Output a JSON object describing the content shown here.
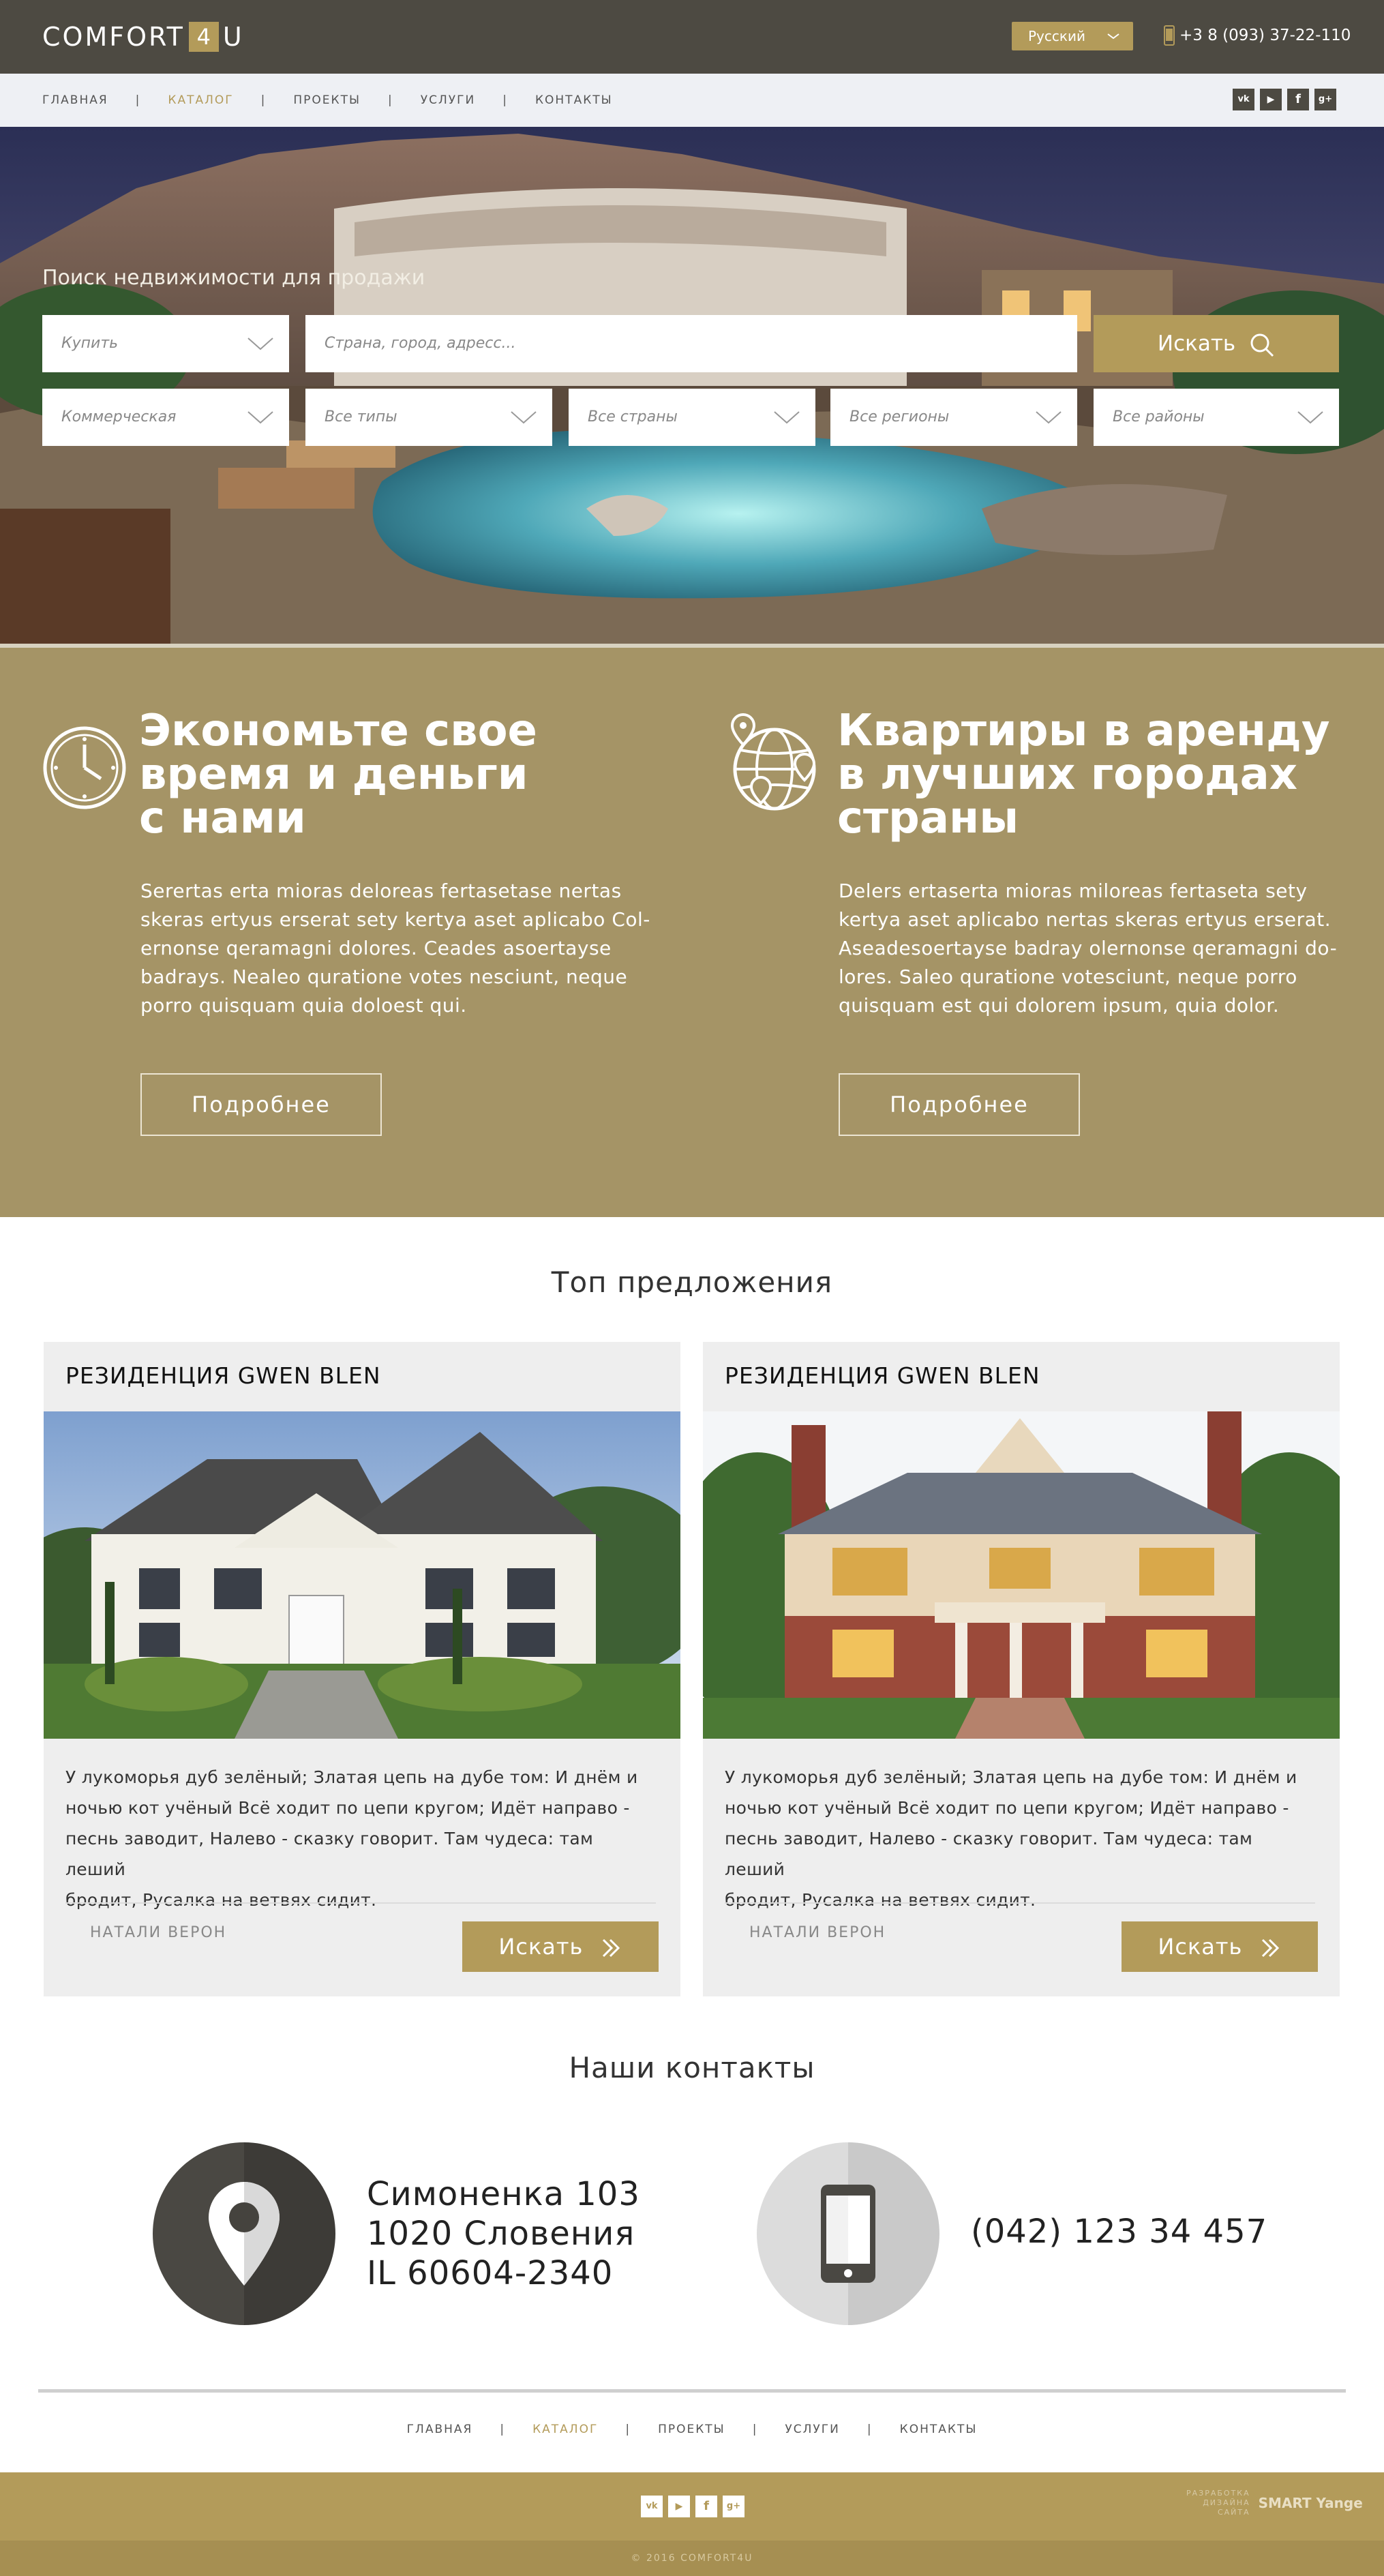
{
  "header": {
    "logo_left": "COMFORT",
    "logo_box": "4",
    "logo_right": "U",
    "language": "Русский",
    "phone": "+3 8 (093) 37-22-110"
  },
  "nav": {
    "items": [
      "ГЛАВНАЯ",
      "КАТАЛОГ",
      "ПРОЕКТЫ",
      "УСЛУГИ",
      "КОНТАКТЫ"
    ],
    "active_index": 1,
    "separator": "|"
  },
  "social": {
    "icons": [
      "vk-icon",
      "youtube-icon",
      "facebook-icon",
      "google-plus-icon"
    ],
    "glyphs": [
      "vk",
      "▶",
      "f",
      "g+"
    ]
  },
  "search": {
    "title": "Поиск недвижимости для продажи",
    "deal_type": "Купить",
    "location_placeholder": "Страна, город, адресс...",
    "button": "Искать",
    "filters": [
      "Коммерческая",
      "Все типы",
      "Все страны",
      "Все регионы",
      "Все районы"
    ]
  },
  "features": [
    {
      "icon": "clock-icon",
      "title_lines": [
        "Экономьте свое",
        "время и деньги",
        "с нами"
      ],
      "text_lines": [
        "Serertas erta mioras deloreas fertasetase nertas",
        "skeras ertyus erserat sety kertya aset aplicabo Col-",
        "ernonse qeramagni dolores. Ceades asoertayse",
        "badrays. Nealeo quratione votes nesciunt, neque",
        "porro quisquam quia doloest qui."
      ],
      "button": "Подробнее"
    },
    {
      "icon": "globe-pins-icon",
      "title_lines": [
        "Квартиры в аренду",
        "в лучших городах",
        "страны"
      ],
      "text_lines": [
        "Delers ertaserta mioras miloreas fertaseta sety",
        "kertya aset aplicabo nertas skeras ertyus erserat.",
        "Aseadesoertayse badray olernonse qeramagni do-",
        "lores. Saleo quratione votesciunt, neque porro",
        "quisquam est qui dolorem ipsum, quia dolor."
      ],
      "button": "Подробнее"
    }
  ],
  "offers": {
    "title": "Топ предложения",
    "cards": [
      {
        "title": "РЕЗИДЕНЦИЯ GWEN BLEN",
        "text_lines": [
          "У лукоморья дуб зелёный; Златая цепь на дубе том: И днём и",
          "ночью кот учёный Всё ходит по цепи кругом; Идёт направо -",
          "песнь заводит, Налево - сказку говорит. Там чудеса: там леший",
          "бродит, Русалка на ветвях сидит."
        ],
        "author": "НАТАЛИ ВЕРОН",
        "button": "Искать"
      },
      {
        "title": "РЕЗИДЕНЦИЯ GWEN BLEN",
        "text_lines": [
          "У лукоморья дуб зелёный; Златая цепь на дубе том: И днём и",
          "ночью кот учёный Всё ходит по цепи кругом; Идёт направо -",
          "песнь заводит, Налево - сказку говорит. Там чудеса: там леший",
          "бродит, Русалка на ветвях сидит."
        ],
        "author": "НАТАЛИ ВЕРОН",
        "button": "Искать"
      }
    ]
  },
  "contacts": {
    "title": "Наши контакты",
    "address_lines": [
      "Симоненка 103",
      "1020 Словения",
      "IL 60604-2340"
    ],
    "phone": "(042) 123 34 457"
  },
  "footer": {
    "copyright": "© 2016 COMFORT4U",
    "developer_lines": [
      "РАЗРАБОТКА",
      "ДИЗАЙНА",
      "САЙТА"
    ],
    "developer_brand": "SMART Yange"
  },
  "colors": {
    "dark": "#4d4a42",
    "gold": "#b39b5a",
    "gold_section": "#a59466",
    "nav_bg": "#eef0f4",
    "card_bg": "#eeeeee"
  }
}
